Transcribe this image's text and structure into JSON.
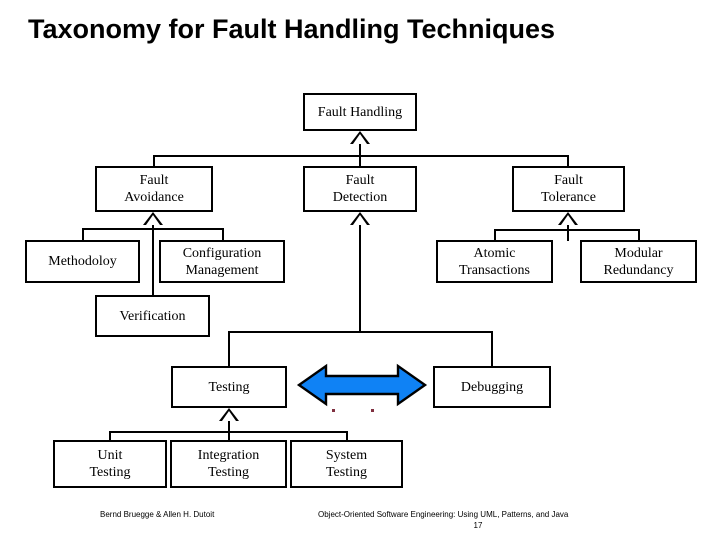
{
  "slide": {
    "title": "Taxonomy for Fault Handling Techniques",
    "background_color": "#ffffff",
    "line_color": "#000000",
    "accent_color": "#0f82f5",
    "artifact_dot_color": "#803040"
  },
  "diagram": {
    "type": "uml-class-taxonomy",
    "root": {
      "label": "Fault Handling"
    },
    "level2": [
      {
        "label": "Fault\nAvoidance"
      },
      {
        "label": "Fault\nDetection"
      },
      {
        "label": "Fault\nTolerance"
      }
    ],
    "avoidance_children": [
      {
        "label": "Methodoloy"
      },
      {
        "label": "Configuration\nManagement"
      },
      {
        "label": "Verification"
      }
    ],
    "tolerance_children": [
      {
        "label": "Atomic\nTransactions"
      },
      {
        "label": "Modular\nRedundancy"
      }
    ],
    "detection_children": [
      {
        "label": "Testing"
      },
      {
        "label": "Debugging"
      }
    ],
    "testing_children": [
      {
        "label": "Unit\nTesting"
      },
      {
        "label": "Integration\nTesting"
      },
      {
        "label": "System\nTesting"
      }
    ],
    "association": {
      "name": "testing-debugging-arrow",
      "style": "double-headed-block-arrow",
      "color": "#0f82f5",
      "from": "Testing",
      "to": "Debugging"
    }
  },
  "footer": {
    "authors": "Bernd Bruegge & Allen H. Dutoit",
    "book": "Object-Oriented Software Engineering: Using UML, Patterns, and Java",
    "page": "17"
  }
}
